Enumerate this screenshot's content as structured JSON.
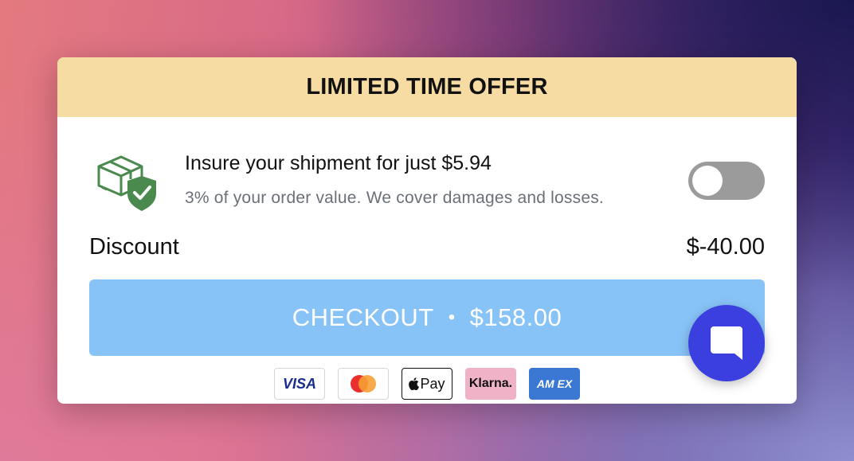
{
  "banner": {
    "title": "LIMITED TIME OFFER"
  },
  "insurance": {
    "title": "Insure your shipment for just $5.94",
    "subtitle": "3% of your order value. We cover damages and losses.",
    "icon": "shield-box-icon",
    "toggle_on": false
  },
  "discount": {
    "label": "Discount",
    "value": "$-40.00"
  },
  "checkout": {
    "label": "CHECKOUT",
    "separator": "•",
    "total": "$158.00"
  },
  "payments": [
    {
      "name": "VISA"
    },
    {
      "name": "Mastercard"
    },
    {
      "name": "Pay"
    },
    {
      "name": "Klarna."
    },
    {
      "name": "AM EX"
    }
  ],
  "colors": {
    "banner_bg": "#f6dca3",
    "checkout_bg": "#88c3f8",
    "chat_button": "#3b3fe0",
    "icon_green": "#4b8a4e"
  }
}
